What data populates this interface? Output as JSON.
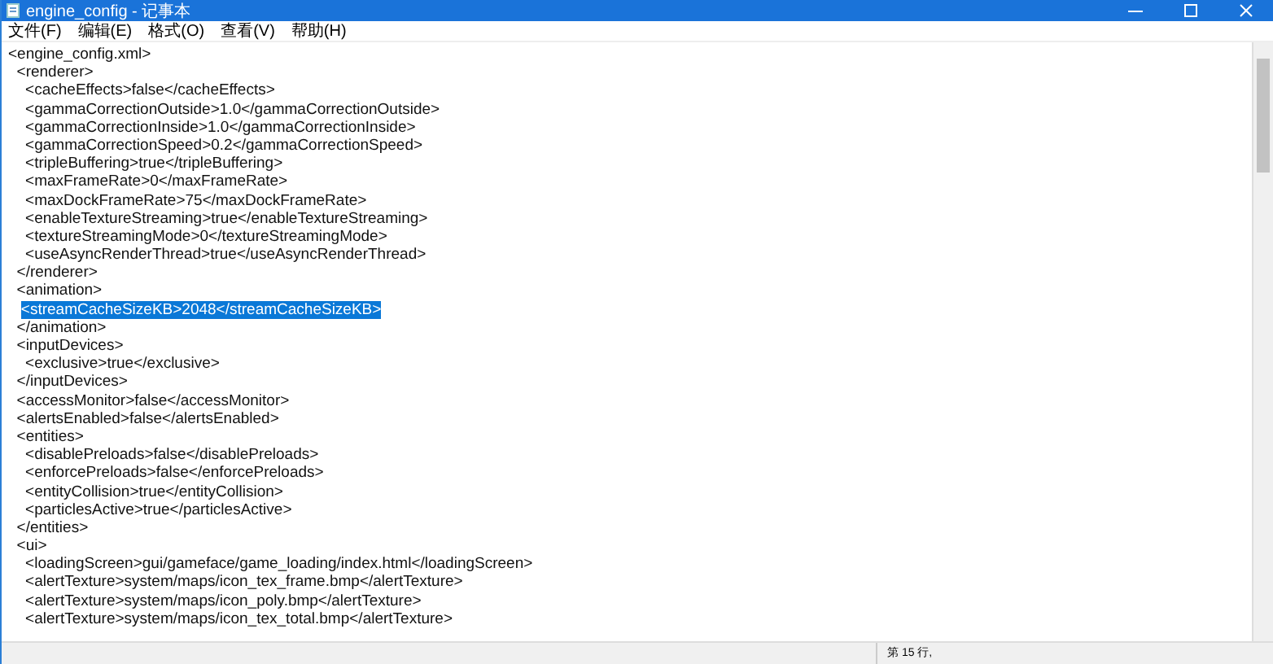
{
  "window": {
    "title": "engine_config - 记事本"
  },
  "menu": [
    "文件(F)",
    "编辑(E)",
    "格式(O)",
    "查看(V)",
    "帮助(H)"
  ],
  "lines": [
    {
      "text": "<engine_config.xml>",
      "selected": false
    },
    {
      "text": "  <renderer>",
      "selected": false
    },
    {
      "text": "    <cacheEffects>false</cacheEffects>",
      "selected": false
    },
    {
      "text": "    <gammaCorrectionOutside>1.0</gammaCorrectionOutside>",
      "selected": false
    },
    {
      "text": "    <gammaCorrectionInside>1.0</gammaCorrectionInside>",
      "selected": false
    },
    {
      "text": "    <gammaCorrectionSpeed>0.2</gammaCorrectionSpeed>",
      "selected": false
    },
    {
      "text": "    <tripleBuffering>true</tripleBuffering>",
      "selected": false
    },
    {
      "text": "    <maxFrameRate>0</maxFrameRate>",
      "selected": false
    },
    {
      "text": "    <maxDockFrameRate>75</maxDockFrameRate>",
      "selected": false
    },
    {
      "text": "    <enableTextureStreaming>true</enableTextureStreaming>",
      "selected": false
    },
    {
      "text": "    <textureStreamingMode>0</textureStreamingMode>",
      "selected": false
    },
    {
      "text": "    <useAsyncRenderThread>true</useAsyncRenderThread>",
      "selected": false
    },
    {
      "text": "  </renderer>",
      "selected": false
    },
    {
      "text": "  <animation>",
      "selected": false
    },
    {
      "text": "   <streamCacheSizeKB>2048</streamCacheSizeKB>",
      "selected": true
    },
    {
      "text": "  </animation>",
      "selected": false
    },
    {
      "text": "  <inputDevices>",
      "selected": false
    },
    {
      "text": "    <exclusive>true</exclusive>",
      "selected": false
    },
    {
      "text": "  </inputDevices>",
      "selected": false
    },
    {
      "text": "  <accessMonitor>false</accessMonitor>",
      "selected": false
    },
    {
      "text": "  <alertsEnabled>false</alertsEnabled>",
      "selected": false
    },
    {
      "text": "  <entities>",
      "selected": false
    },
    {
      "text": "    <disablePreloads>false</disablePreloads>",
      "selected": false
    },
    {
      "text": "    <enforcePreloads>false</enforcePreloads>",
      "selected": false
    },
    {
      "text": "    <entityCollision>true</entityCollision>",
      "selected": false
    },
    {
      "text": "    <particlesActive>true</particlesActive>",
      "selected": false
    },
    {
      "text": "  </entities>",
      "selected": false
    },
    {
      "text": "  <ui>",
      "selected": false
    },
    {
      "text": "    <loadingScreen>gui/gameface/game_loading/index.html</loadingScreen>",
      "selected": false
    },
    {
      "text": "    <alertTexture>system/maps/icon_tex_frame.bmp</alertTexture>",
      "selected": false
    },
    {
      "text": "    <alertTexture>system/maps/icon_poly.bmp</alertTexture>",
      "selected": false
    },
    {
      "text": "    <alertTexture>system/maps/icon_tex_total.bmp</alertTexture>",
      "selected": false
    }
  ],
  "status_bar": {
    "position": "第 15 行,"
  }
}
